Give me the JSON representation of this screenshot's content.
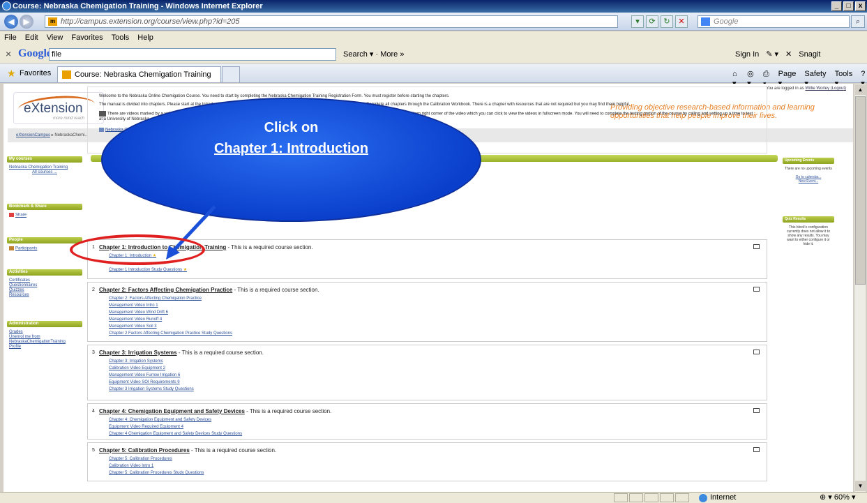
{
  "browser": {
    "title": "Course: Nebraska Chemigation Training - Windows Internet Explorer",
    "url": "http://campus.extension.org/course/view.php?id=205",
    "search_placeholder": "Google",
    "menu": [
      "File",
      "Edit",
      "View",
      "Favorites",
      "Tools",
      "Help"
    ],
    "google_query": "file",
    "google_search_label": "Search ▾ · More »",
    "google_right": [
      "Sign In",
      "✎ ▾",
      "✕",
      "Snagit"
    ],
    "favorites_label": "Favorites",
    "tab_label": "Course: Nebraska Chemigation Training",
    "command_bar": [
      "Page ▾",
      "Safety ▾",
      "Tools ▾"
    ],
    "status_zone": "Internet",
    "zoom": "60%"
  },
  "site": {
    "logo_text": "eXtension",
    "logo_tag": "more mind reach",
    "logged_in": "You are logged in as",
    "logged_in_user": "Willie Worley (Logout)",
    "slogan": "Providing objective research-based information and learning opportunities that help people improve their lives.",
    "breadcrumb_home": "eXtensionCampus",
    "breadcrumb_course": "NebraskaChemi..."
  },
  "sidebar": {
    "my_courses": {
      "title": "My courses",
      "items": [
        "Nebraska Chemigation Training"
      ],
      "all": "All courses ..."
    },
    "bookmark": {
      "title": "Bookmark & Share",
      "item": "Share"
    },
    "people": {
      "title": "People",
      "item": "Participants"
    },
    "activities": {
      "title": "Activities",
      "items": [
        "Certificates",
        "Questionnaires",
        "Quizzes",
        "Resources"
      ]
    },
    "admin": {
      "title": "Administration",
      "items": [
        "Grades",
        "Unenrol me from NebraskaChemigationTraining",
        "Profile"
      ]
    }
  },
  "right": {
    "events": {
      "title": "Upcoming Events",
      "text": "There are no upcoming events",
      "link1": "Go to calendar...",
      "link2": "New Event..."
    },
    "quiz": {
      "title": "Quiz Results",
      "text": "This block's configuration currently does not allow it to show any results. You may want to either configure it or hide it."
    }
  },
  "intro": {
    "p1": "Welcome to the Nebraska Online Chemigation Course. You need to start by completing the Nebraska Chemigation Training Registration Form. You must register before starting the chapters.",
    "p2": "The manual is divided into chapters. Please start at the Introduction chapter, complete the activities and videos and proceed to the next chapter. Complete all chapters through the Calibration Workbook. There is a chapter with resources that are not required but you may find them helpful.",
    "p3": "There are videos marked by a video icon that you need to watch before proceeding to the next module. You will notice on the videos there is a toggle button in the bottom right corner of the video which you can click to view the videos in fullscreen mode. You will need to complete the testing portion of the course by calling and setting up a time to test at a University of Nebraska extension office that offers the testing service.",
    "form_link": "Nebraska Chemigation Training Registration Form"
  },
  "sections": [
    {
      "num": "1",
      "title": "Chapter 1: Introduction to Chemigation Training",
      "suffix": " - This is a required course section.",
      "items": [
        "Chapter 1: Introduction",
        "Chapter 1 Introduction Study Questions"
      ]
    },
    {
      "num": "2",
      "title": "Chapter 2: Factors Affecting Chemigation Practice",
      "suffix": " - This is a required course section.",
      "items": [
        "Chapter 2: Factors Affecting Chemigation Practice",
        "Management Video Intro 1",
        "Management Video Wind Drift 6",
        "Management Video Runoff 4",
        "Management Video Soil 3",
        "Chapter 2 Factors Affecting Chemigation Practice Study Questions"
      ]
    },
    {
      "num": "3",
      "title": "Chapter 3: Irrigation Systems",
      "suffix": " - This is a required course section.",
      "items": [
        "Chapter 3: Irrigation Systems",
        "Calibration Video Equipment 2",
        "Management Video Furrow Irrigation 6",
        "Equipment Video SOI Requirements 9",
        "Chapter 3 Irrigation Systems Study Questions"
      ]
    },
    {
      "num": "4",
      "title": "Chapter 4: Chemigation Equipment and Safety Devices",
      "suffix": " - This is a required course section.",
      "items": [
        "Chapter 4: Chemigation Equipment and Safety Devices",
        "Equipment Video Required Equipment 4",
        "Chapter 4 Chemigation Equipment and Safety Devices Study Questions"
      ]
    },
    {
      "num": "5",
      "title": "Chapter 5: Calibration Procedures",
      "suffix": " - This is a required course section.",
      "items": [
        "Chapter 5: Calibration Procedures",
        "Calibration Video Intro 1",
        "Chapter 5: Calibration Procedures Study Questions"
      ]
    }
  ],
  "callout": {
    "line1": "Click on",
    "line2": "Chapter 1:  Introduction"
  }
}
